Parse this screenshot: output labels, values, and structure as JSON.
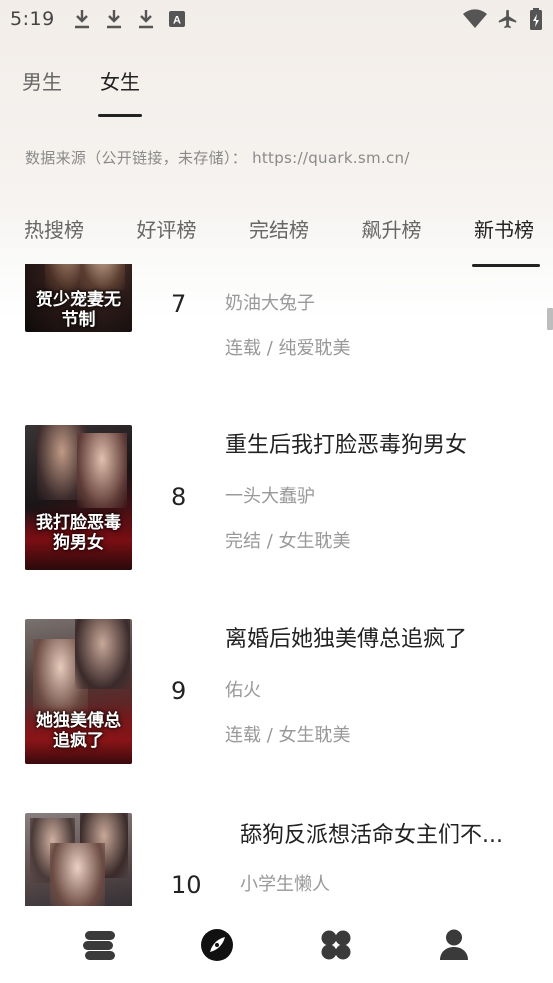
{
  "status_bar": {
    "time": "5:19",
    "badge": "A"
  },
  "gender_tabs": [
    {
      "label": "男生",
      "active": false
    },
    {
      "label": "女生",
      "active": true
    }
  ],
  "data_source": "数据来源（公开链接，未存储）：  https://quark.sm.cn/",
  "rank_tabs": [
    {
      "label": "热搜榜",
      "active": false
    },
    {
      "label": "好评榜",
      "active": false
    },
    {
      "label": "完结榜",
      "active": false
    },
    {
      "label": "飙升榜",
      "active": false
    },
    {
      "label": "新书榜",
      "active": true
    }
  ],
  "books": [
    {
      "rank": "7",
      "title": "",
      "author": "奶油大兔子",
      "meta": "连载 / 纯爱耽美",
      "cover_text": "贺少宠妻无节制"
    },
    {
      "rank": "8",
      "title": "重生后我打脸恶毒狗男女",
      "author": "一头大蠢驴",
      "meta": "完结 / 女生耽美",
      "cover_text": "我打脸恶毒狗男女"
    },
    {
      "rank": "9",
      "title": "离婚后她独美傅总追疯了",
      "author": "佑火",
      "meta": "连载 / 女生耽美",
      "cover_text": "她独美傅总追疯了"
    },
    {
      "rank": "10",
      "title": "舔狗反派想活命女主们不...",
      "author": "小学生懒人",
      "meta": "",
      "cover_text": ""
    }
  ],
  "bottom_nav": [
    {
      "icon": "bookshelf-icon",
      "active": false
    },
    {
      "icon": "compass-icon",
      "active": true
    },
    {
      "icon": "category-icon",
      "active": false
    },
    {
      "icon": "profile-icon",
      "active": false
    }
  ],
  "colors": {
    "text_primary": "#222222",
    "text_secondary": "#999999",
    "accent": "#222222",
    "background_top": "#f2ede9"
  }
}
